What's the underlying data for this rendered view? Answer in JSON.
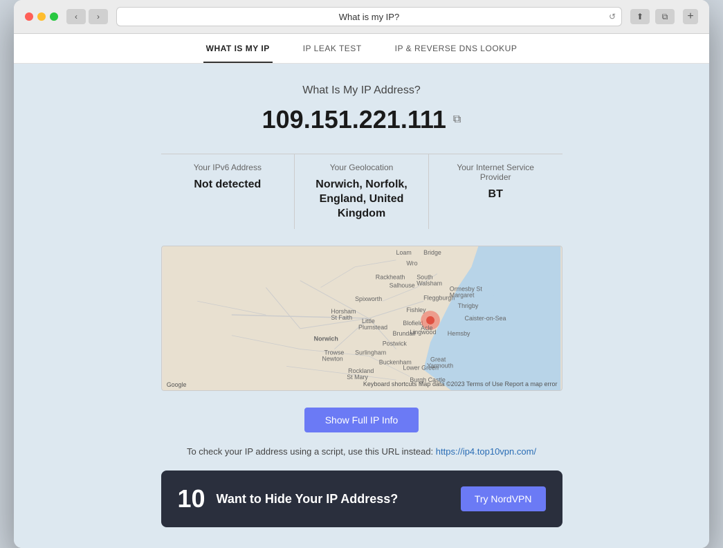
{
  "browser": {
    "url": "What is my IP?",
    "back_label": "‹",
    "forward_label": "›",
    "refresh_label": "↺",
    "share_label": "⬆",
    "add_label": "+"
  },
  "nav": {
    "items": [
      {
        "id": "what-is-my-ip",
        "label": "WHAT IS MY IP",
        "active": true
      },
      {
        "id": "ip-leak-test",
        "label": "IP LEAK TEST",
        "active": false
      },
      {
        "id": "ip-reverse-dns",
        "label": "IP & REVERSE DNS LOOKUP",
        "active": false
      }
    ]
  },
  "main": {
    "page_title": "What Is My IP Address?",
    "ip_address": "109.151.221.111",
    "copy_icon": "⧉",
    "ipv6": {
      "label": "Your IPv6 Address",
      "value": "Not detected"
    },
    "geolocation": {
      "label": "Your Geolocation",
      "value": "Norwich, Norfolk, England, United Kingdom"
    },
    "isp": {
      "label": "Your Internet Service Provider",
      "value": "BT"
    },
    "show_full_ip_btn": "Show Full IP Info",
    "script_note": "To check your IP address using a script, use this URL instead:",
    "script_url": "https://ip4.top10vpn.com/",
    "map_footer": "Keyboard shortcuts  Map data ©2023  Terms of Use  Report a map error",
    "map_footer_left": "Google"
  },
  "banner": {
    "number": "10",
    "title": "Want to Hide Your IP Address?",
    "btn_label": "Try NordVPN"
  }
}
